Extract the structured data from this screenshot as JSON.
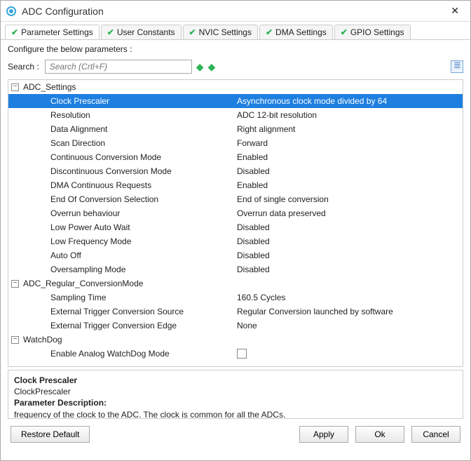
{
  "window": {
    "title": "ADC Configuration"
  },
  "tabs": [
    {
      "label": "Parameter Settings"
    },
    {
      "label": "User Constants"
    },
    {
      "label": "NVIC Settings"
    },
    {
      "label": "DMA Settings"
    },
    {
      "label": "GPIO Settings"
    }
  ],
  "subtitle": "Configure the below parameters :",
  "search": {
    "label": "Search :",
    "placeholder": "Search (Crtl+F)"
  },
  "groups": {
    "g0": {
      "name": "ADC_Settings"
    },
    "g1": {
      "name": "ADC_Regular_ConversionMode"
    },
    "g2": {
      "name": "WatchDog"
    }
  },
  "params": {
    "p0": {
      "key": "Clock Prescaler",
      "val": "Asynchronous clock mode divided by 64"
    },
    "p1": {
      "key": "Resolution",
      "val": "ADC 12-bit resolution"
    },
    "p2": {
      "key": "Data Alignment",
      "val": "Right alignment"
    },
    "p3": {
      "key": "Scan Direction",
      "val": "Forward"
    },
    "p4": {
      "key": "Continuous Conversion Mode",
      "val": "Enabled"
    },
    "p5": {
      "key": "Discontinuous Conversion Mode",
      "val": "Disabled"
    },
    "p6": {
      "key": "DMA Continuous Requests",
      "val": "Enabled"
    },
    "p7": {
      "key": "End Of Conversion Selection",
      "val": "End of single conversion"
    },
    "p8": {
      "key": "Overrun behaviour",
      "val": "Overrun data preserved"
    },
    "p9": {
      "key": "Low Power Auto Wait",
      "val": "Disabled"
    },
    "p10": {
      "key": "Low Frequency Mode",
      "val": "Disabled"
    },
    "p11": {
      "key": "Auto Off",
      "val": "Disabled"
    },
    "p12": {
      "key": "Oversampling Mode",
      "val": "Disabled"
    },
    "p13": {
      "key": "Sampling Time",
      "val": "160.5 Cycles"
    },
    "p14": {
      "key": "External Trigger Conversion Source",
      "val": "Regular Conversion launched by software"
    },
    "p15": {
      "key": "External Trigger Conversion Edge",
      "val": "None"
    },
    "p16": {
      "key": "Enable Analog WatchDog Mode",
      "val": ""
    }
  },
  "desc": {
    "title": "Clock Prescaler",
    "internal": "ClockPrescaler",
    "heading": "Parameter Description:",
    "text": "frequency of the clock to the ADC. The clock is common for all the ADCs."
  },
  "buttons": {
    "restore": "Restore Default",
    "apply": "Apply",
    "ok": "Ok",
    "cancel": "Cancel"
  }
}
